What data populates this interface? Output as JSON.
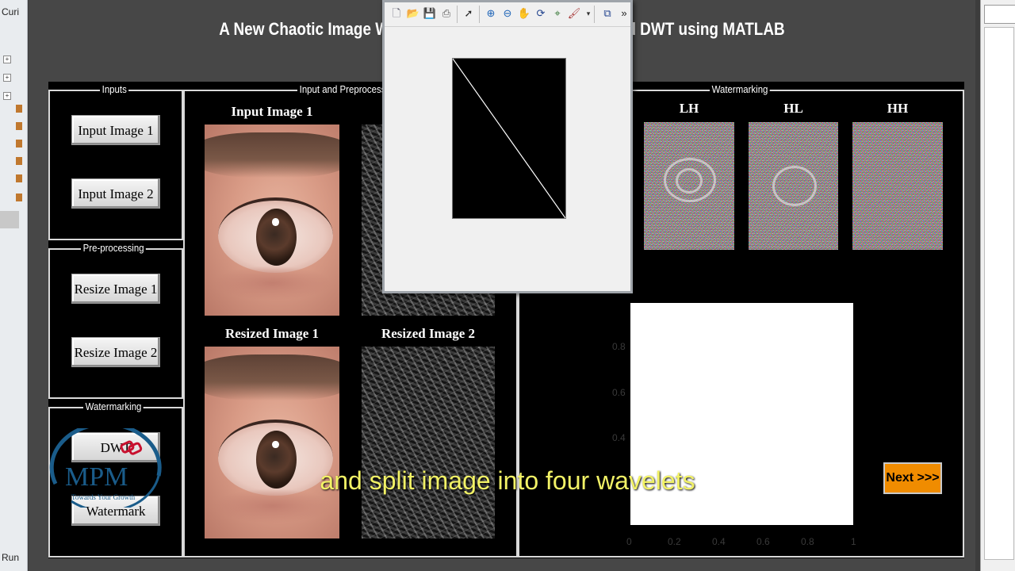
{
  "ide": {
    "left_tab": "Curi",
    "bottom_label": "Run"
  },
  "title": "A New Chaotic Image Watermarking using Arnold Map and DWT using MATLAB",
  "panels": {
    "inputs": {
      "title": "Inputs",
      "buttons": [
        "Input Image 1",
        "Input Image 2"
      ]
    },
    "preprocessing": {
      "title": "Pre-processing",
      "buttons": [
        "Resize Image 1",
        "Resize Image 2"
      ]
    },
    "watermarking_controls": {
      "title": "Watermarking",
      "buttons": [
        "DWT",
        "Watermark"
      ]
    },
    "input_preprocess": {
      "title": "Input and Preprocess",
      "labels": {
        "input1": "Input Image 1",
        "resized1": "Resized Image 1",
        "resized2": "Resized Image 2"
      }
    },
    "watermarking_view": {
      "title": "Watermarking",
      "bands": [
        "LH",
        "HL",
        "HH"
      ]
    }
  },
  "axes": {
    "y_ticks": [
      "0.8",
      "0.6",
      "0.4"
    ],
    "x_ticks": [
      "0",
      "0.2",
      "0.4",
      "0.6",
      "0.8",
      "1"
    ],
    "xlim": [
      0,
      1
    ],
    "ylim": [
      0,
      1
    ]
  },
  "next_button": "Next >>>",
  "popup_toolbar": {
    "icons": [
      "new-file-icon",
      "open-folder-icon",
      "save-icon",
      "print-icon",
      "pointer-icon",
      "zoom-in-icon",
      "zoom-out-icon",
      "pan-hand-icon",
      "rotate-3d-icon",
      "data-cursor-icon",
      "brush-icon",
      "dock-icon"
    ],
    "overflow": "»"
  },
  "logo": {
    "text": "MPM",
    "tagline": "Towards Your Growth"
  },
  "subtitle": "and split image into four wavelets",
  "colors": {
    "figure_bg": "#474747",
    "panel_bg": "#000000",
    "next_button": "#f08c00",
    "subtitle": "#f2f266",
    "logo": "#1a5c8a"
  }
}
